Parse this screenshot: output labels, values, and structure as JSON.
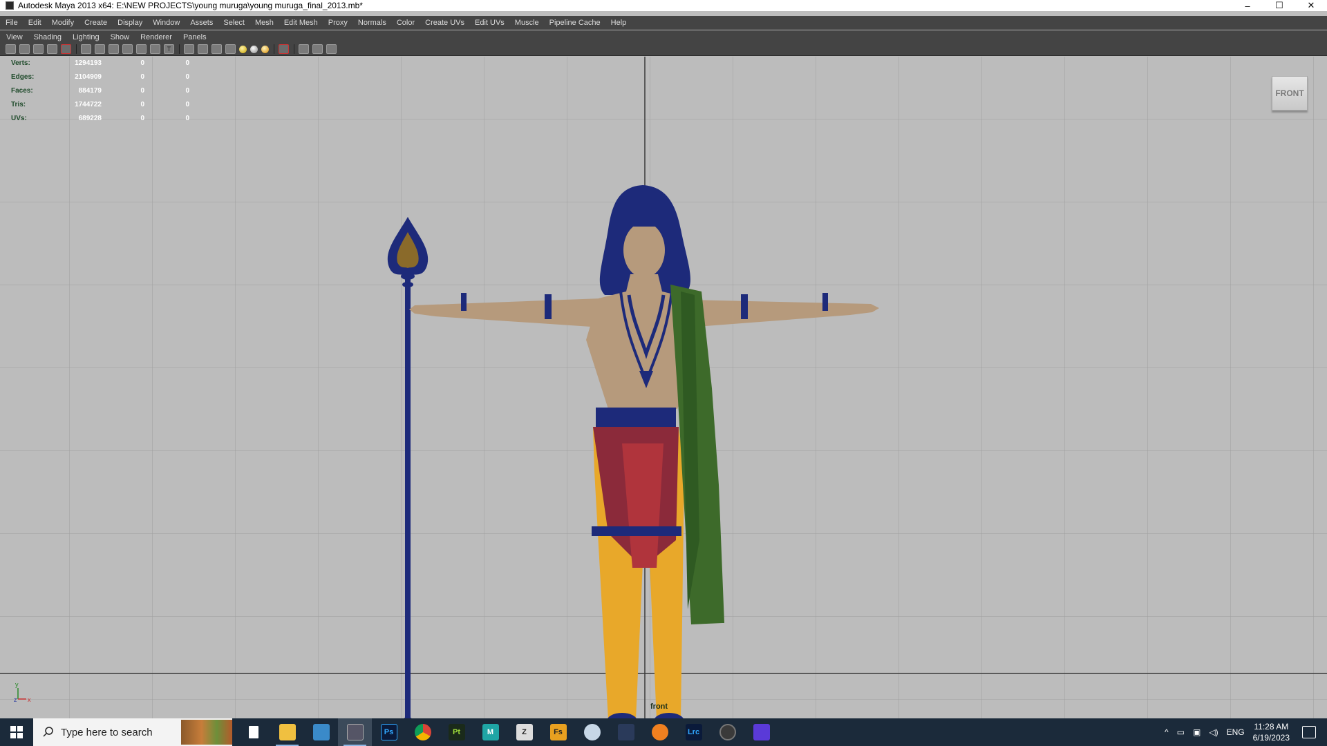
{
  "window": {
    "title": "Autodesk Maya 2013 x64: E:\\NEW PROJECTS\\young muruga\\young muruga_final_2013.mb*",
    "controls": [
      "–",
      "☐",
      "✕"
    ]
  },
  "main_menu": [
    "File",
    "Edit",
    "Modify",
    "Create",
    "Display",
    "Window",
    "Assets",
    "Select",
    "Mesh",
    "Edit Mesh",
    "Proxy",
    "Normals",
    "Color",
    "Create UVs",
    "Edit UVs",
    "Muscle",
    "Pipeline Cache",
    "Help"
  ],
  "panel_menu": [
    "View",
    "Shading",
    "Lighting",
    "Show",
    "Renderer",
    "Panels"
  ],
  "hud": {
    "rows": [
      {
        "label": "Verts:",
        "v1": "1294193",
        "v2": "0",
        "v3": "0"
      },
      {
        "label": "Edges:",
        "v1": "2104909",
        "v2": "0",
        "v3": "0"
      },
      {
        "label": "Faces:",
        "v1": "884179",
        "v2": "0",
        "v3": "0"
      },
      {
        "label": "Tris:",
        "v1": "1744722",
        "v2": "0",
        "v3": "0"
      },
      {
        "label": "UVs:",
        "v1": "689228",
        "v2": "0",
        "v3": "0"
      }
    ]
  },
  "viewcube_label": "FRONT",
  "camera_label": "front",
  "axis": {
    "y": "y",
    "z": "z",
    "x": "x"
  },
  "taskbar": {
    "search_placeholder": "Type here to search",
    "apps": [
      "file",
      "explorer",
      "maya-feather",
      "maya-active",
      "Ps",
      "chrome",
      "Pt",
      "M",
      "zbrush",
      "Fs",
      "paint",
      "davinci",
      "blender",
      "Lrc",
      "obs",
      "marmoset"
    ],
    "tray_lang": "ENG",
    "time": "11:28 AM",
    "date": "6/19/2023"
  }
}
